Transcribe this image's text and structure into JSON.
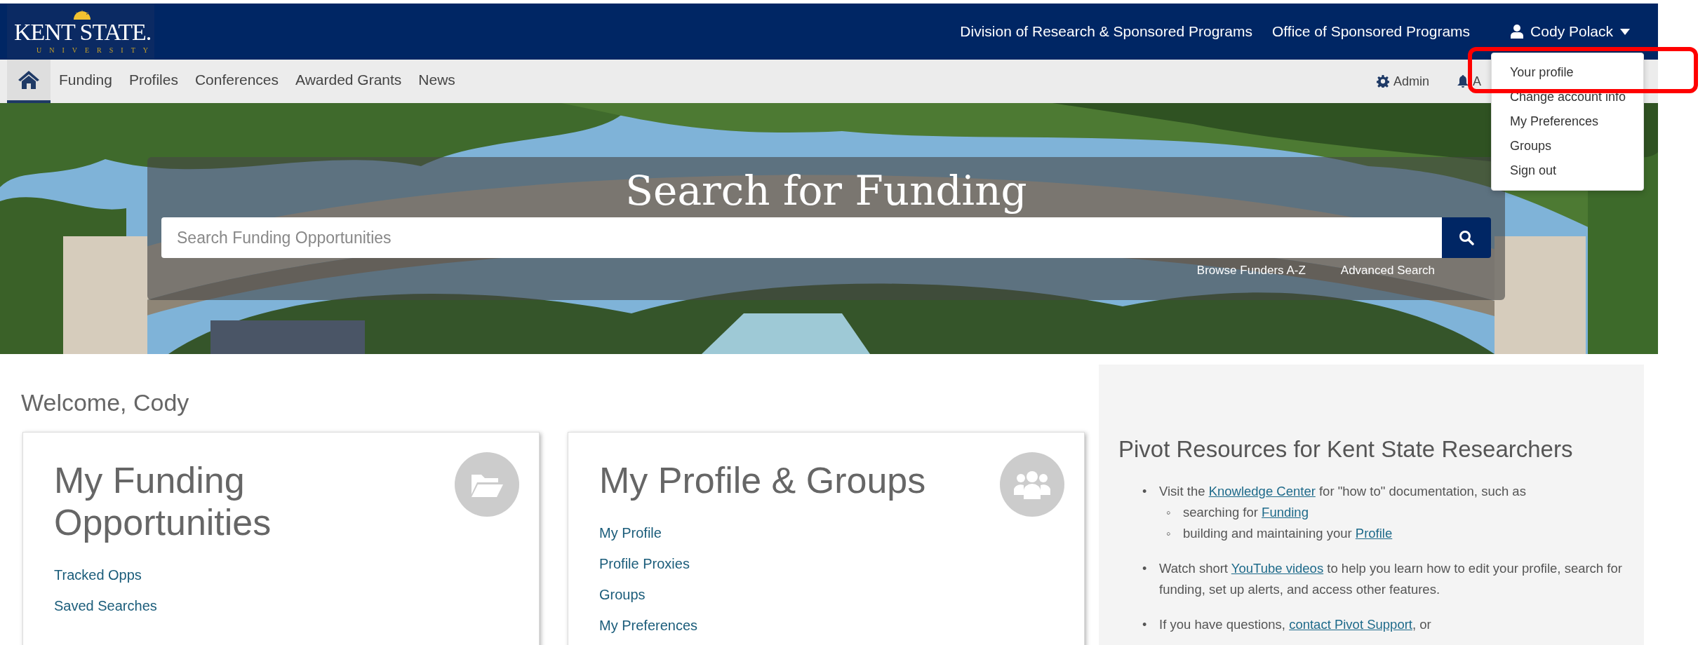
{
  "header": {
    "logo": {
      "wordmark": "KENT STATE.",
      "subtitle": "UNIVERSITY"
    },
    "links": [
      "Division of Research & Sponsored Programs",
      "Office of Sponsored Programs"
    ],
    "user": {
      "name": "Cody Polack",
      "menu_open": true
    }
  },
  "nav": {
    "home_selected": true,
    "items": [
      {
        "label": "Funding",
        "selected": false
      },
      {
        "label": "Profiles",
        "selected": false
      },
      {
        "label": "Conferences",
        "selected": false
      },
      {
        "label": "Awarded Grants",
        "selected": false
      },
      {
        "label": "News",
        "selected": false
      }
    ],
    "tools": [
      {
        "kind": "admin",
        "label": "Admin"
      },
      {
        "kind": "alerts",
        "label": "A"
      }
    ]
  },
  "user_menu": {
    "items": [
      {
        "label": "Your profile",
        "highlighted": true
      },
      {
        "label": "Change account info",
        "highlighted": false
      },
      {
        "label": "My Preferences",
        "highlighted": false
      },
      {
        "label": "Groups",
        "highlighted": false
      },
      {
        "label": "Sign out",
        "highlighted": false
      }
    ]
  },
  "hero": {
    "title": "Search for Funding",
    "search": {
      "placeholder": "Search Funding Opportunities"
    },
    "links": [
      "Browse Funders A-Z",
      "Advanced Search"
    ]
  },
  "welcome": "Welcome, Cody",
  "cards": [
    {
      "title": "My Funding Opportunities",
      "kind": "folder",
      "links": [
        "Tracked Opps",
        "Saved Searches"
      ]
    },
    {
      "title": "My Profile & Groups",
      "kind": "users",
      "links": [
        "My Profile",
        "Profile Proxies",
        "Groups",
        "My Preferences"
      ]
    }
  ],
  "resources": {
    "title": "Pivot Resources for Kent State Researchers",
    "items": [
      {
        "bullet": "•",
        "parts": [
          {
            "text": "Visit the "
          },
          {
            "link": "Knowledge Center"
          },
          {
            "text": " for \"how to\" documentation, such as"
          }
        ],
        "children": [
          {
            "bullet": "◦",
            "parts": [
              {
                "text": "searching for "
              },
              {
                "link": "Funding"
              }
            ]
          },
          {
            "bullet": "◦",
            "parts": [
              {
                "text": "building and maintaining your "
              },
              {
                "link": "Profile"
              }
            ]
          }
        ]
      },
      {
        "bullet": "•",
        "parts": [
          {
            "text": "Watch short "
          },
          {
            "link": "YouTube videos"
          },
          {
            "text": " to help you learn how to edit your profile, search for funding, set up alerts, and access other features."
          }
        ]
      },
      {
        "bullet": "•",
        "parts": [
          {
            "text": "If you have questions, "
          },
          {
            "link": "contact Pivot Support"
          },
          {
            "text": ", or"
          }
        ]
      }
    ]
  }
}
